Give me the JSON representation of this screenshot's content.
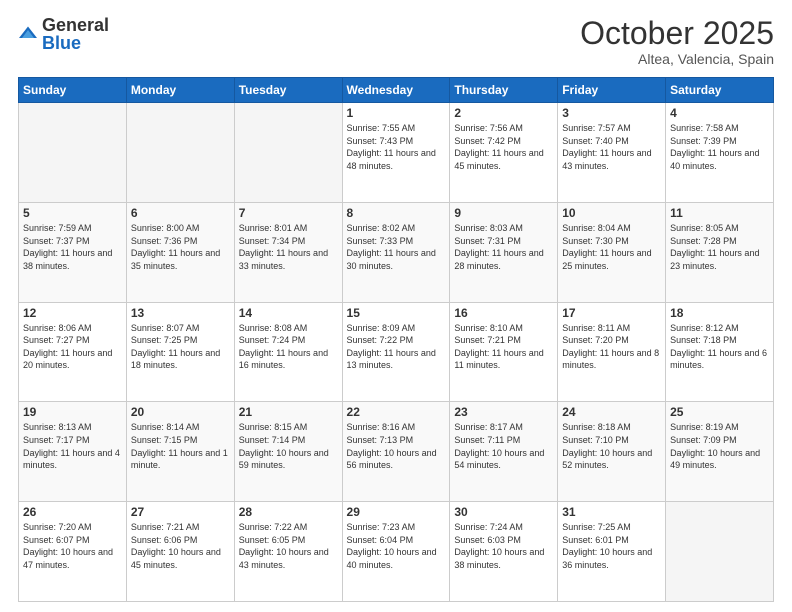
{
  "logo": {
    "general": "General",
    "blue": "Blue"
  },
  "header": {
    "month": "October 2025",
    "location": "Altea, Valencia, Spain"
  },
  "weekdays": [
    "Sunday",
    "Monday",
    "Tuesday",
    "Wednesday",
    "Thursday",
    "Friday",
    "Saturday"
  ],
  "weeks": [
    [
      {
        "day": "",
        "sunrise": "",
        "sunset": "",
        "daylight": ""
      },
      {
        "day": "",
        "sunrise": "",
        "sunset": "",
        "daylight": ""
      },
      {
        "day": "",
        "sunrise": "",
        "sunset": "",
        "daylight": ""
      },
      {
        "day": "1",
        "sunrise": "Sunrise: 7:55 AM",
        "sunset": "Sunset: 7:43 PM",
        "daylight": "Daylight: 11 hours and 48 minutes."
      },
      {
        "day": "2",
        "sunrise": "Sunrise: 7:56 AM",
        "sunset": "Sunset: 7:42 PM",
        "daylight": "Daylight: 11 hours and 45 minutes."
      },
      {
        "day": "3",
        "sunrise": "Sunrise: 7:57 AM",
        "sunset": "Sunset: 7:40 PM",
        "daylight": "Daylight: 11 hours and 43 minutes."
      },
      {
        "day": "4",
        "sunrise": "Sunrise: 7:58 AM",
        "sunset": "Sunset: 7:39 PM",
        "daylight": "Daylight: 11 hours and 40 minutes."
      }
    ],
    [
      {
        "day": "5",
        "sunrise": "Sunrise: 7:59 AM",
        "sunset": "Sunset: 7:37 PM",
        "daylight": "Daylight: 11 hours and 38 minutes."
      },
      {
        "day": "6",
        "sunrise": "Sunrise: 8:00 AM",
        "sunset": "Sunset: 7:36 PM",
        "daylight": "Daylight: 11 hours and 35 minutes."
      },
      {
        "day": "7",
        "sunrise": "Sunrise: 8:01 AM",
        "sunset": "Sunset: 7:34 PM",
        "daylight": "Daylight: 11 hours and 33 minutes."
      },
      {
        "day": "8",
        "sunrise": "Sunrise: 8:02 AM",
        "sunset": "Sunset: 7:33 PM",
        "daylight": "Daylight: 11 hours and 30 minutes."
      },
      {
        "day": "9",
        "sunrise": "Sunrise: 8:03 AM",
        "sunset": "Sunset: 7:31 PM",
        "daylight": "Daylight: 11 hours and 28 minutes."
      },
      {
        "day": "10",
        "sunrise": "Sunrise: 8:04 AM",
        "sunset": "Sunset: 7:30 PM",
        "daylight": "Daylight: 11 hours and 25 minutes."
      },
      {
        "day": "11",
        "sunrise": "Sunrise: 8:05 AM",
        "sunset": "Sunset: 7:28 PM",
        "daylight": "Daylight: 11 hours and 23 minutes."
      }
    ],
    [
      {
        "day": "12",
        "sunrise": "Sunrise: 8:06 AM",
        "sunset": "Sunset: 7:27 PM",
        "daylight": "Daylight: 11 hours and 20 minutes."
      },
      {
        "day": "13",
        "sunrise": "Sunrise: 8:07 AM",
        "sunset": "Sunset: 7:25 PM",
        "daylight": "Daylight: 11 hours and 18 minutes."
      },
      {
        "day": "14",
        "sunrise": "Sunrise: 8:08 AM",
        "sunset": "Sunset: 7:24 PM",
        "daylight": "Daylight: 11 hours and 16 minutes."
      },
      {
        "day": "15",
        "sunrise": "Sunrise: 8:09 AM",
        "sunset": "Sunset: 7:22 PM",
        "daylight": "Daylight: 11 hours and 13 minutes."
      },
      {
        "day": "16",
        "sunrise": "Sunrise: 8:10 AM",
        "sunset": "Sunset: 7:21 PM",
        "daylight": "Daylight: 11 hours and 11 minutes."
      },
      {
        "day": "17",
        "sunrise": "Sunrise: 8:11 AM",
        "sunset": "Sunset: 7:20 PM",
        "daylight": "Daylight: 11 hours and 8 minutes."
      },
      {
        "day": "18",
        "sunrise": "Sunrise: 8:12 AM",
        "sunset": "Sunset: 7:18 PM",
        "daylight": "Daylight: 11 hours and 6 minutes."
      }
    ],
    [
      {
        "day": "19",
        "sunrise": "Sunrise: 8:13 AM",
        "sunset": "Sunset: 7:17 PM",
        "daylight": "Daylight: 11 hours and 4 minutes."
      },
      {
        "day": "20",
        "sunrise": "Sunrise: 8:14 AM",
        "sunset": "Sunset: 7:15 PM",
        "daylight": "Daylight: 11 hours and 1 minute."
      },
      {
        "day": "21",
        "sunrise": "Sunrise: 8:15 AM",
        "sunset": "Sunset: 7:14 PM",
        "daylight": "Daylight: 10 hours and 59 minutes."
      },
      {
        "day": "22",
        "sunrise": "Sunrise: 8:16 AM",
        "sunset": "Sunset: 7:13 PM",
        "daylight": "Daylight: 10 hours and 56 minutes."
      },
      {
        "day": "23",
        "sunrise": "Sunrise: 8:17 AM",
        "sunset": "Sunset: 7:11 PM",
        "daylight": "Daylight: 10 hours and 54 minutes."
      },
      {
        "day": "24",
        "sunrise": "Sunrise: 8:18 AM",
        "sunset": "Sunset: 7:10 PM",
        "daylight": "Daylight: 10 hours and 52 minutes."
      },
      {
        "day": "25",
        "sunrise": "Sunrise: 8:19 AM",
        "sunset": "Sunset: 7:09 PM",
        "daylight": "Daylight: 10 hours and 49 minutes."
      }
    ],
    [
      {
        "day": "26",
        "sunrise": "Sunrise: 7:20 AM",
        "sunset": "Sunset: 6:07 PM",
        "daylight": "Daylight: 10 hours and 47 minutes."
      },
      {
        "day": "27",
        "sunrise": "Sunrise: 7:21 AM",
        "sunset": "Sunset: 6:06 PM",
        "daylight": "Daylight: 10 hours and 45 minutes."
      },
      {
        "day": "28",
        "sunrise": "Sunrise: 7:22 AM",
        "sunset": "Sunset: 6:05 PM",
        "daylight": "Daylight: 10 hours and 43 minutes."
      },
      {
        "day": "29",
        "sunrise": "Sunrise: 7:23 AM",
        "sunset": "Sunset: 6:04 PM",
        "daylight": "Daylight: 10 hours and 40 minutes."
      },
      {
        "day": "30",
        "sunrise": "Sunrise: 7:24 AM",
        "sunset": "Sunset: 6:03 PM",
        "daylight": "Daylight: 10 hours and 38 minutes."
      },
      {
        "day": "31",
        "sunrise": "Sunrise: 7:25 AM",
        "sunset": "Sunset: 6:01 PM",
        "daylight": "Daylight: 10 hours and 36 minutes."
      },
      {
        "day": "",
        "sunrise": "",
        "sunset": "",
        "daylight": ""
      }
    ]
  ]
}
